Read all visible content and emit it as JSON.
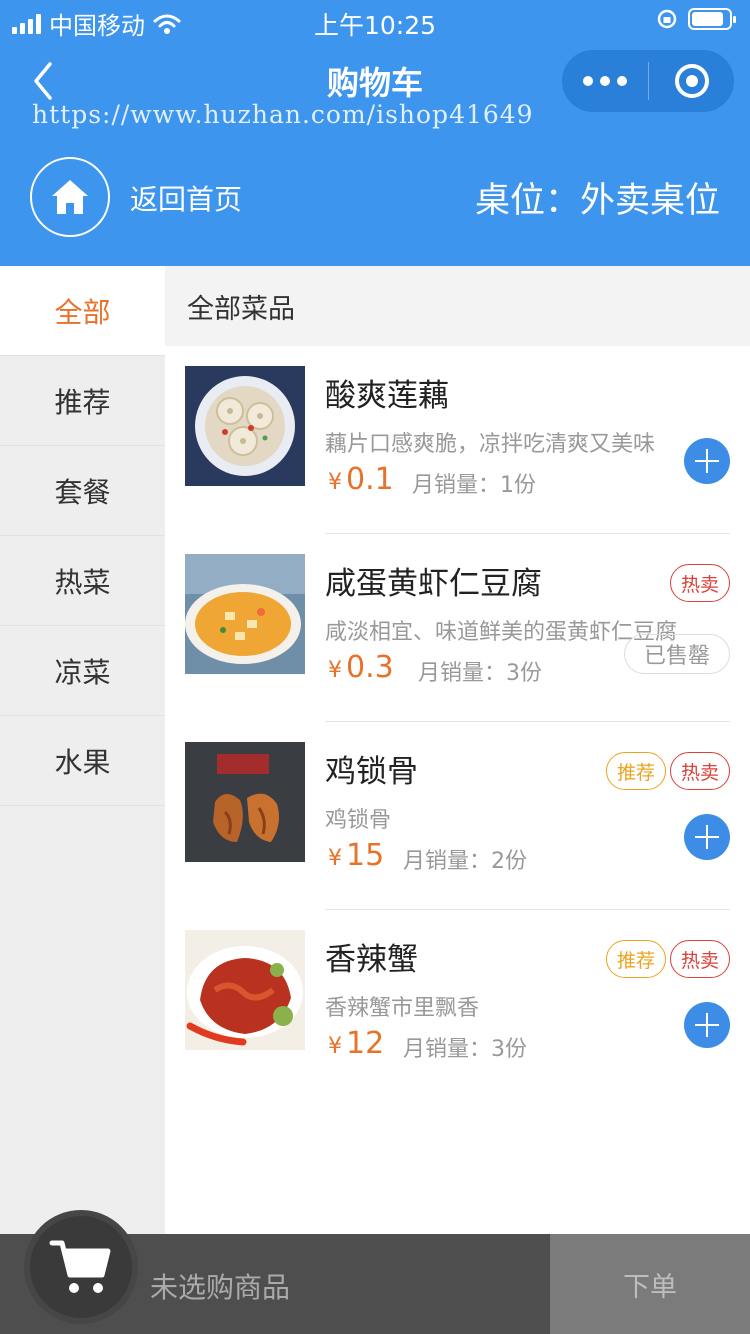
{
  "status_bar": {
    "carrier": "中国移动",
    "time": "上午10:25",
    "battery_level": 0.85
  },
  "nav": {
    "title": "购物车",
    "watermark": "https://www.huzhan.com/ishop41649"
  },
  "header": {
    "home_label": "返回首页",
    "table_info": "桌位：外卖桌位"
  },
  "categories": [
    {
      "label": "全部",
      "active": true
    },
    {
      "label": "推荐",
      "active": false
    },
    {
      "label": "套餐",
      "active": false
    },
    {
      "label": "热菜",
      "active": false
    },
    {
      "label": "凉菜",
      "active": false
    },
    {
      "label": "水果",
      "active": false
    }
  ],
  "section_title": "全部菜品",
  "currency_symbol": "¥",
  "items": [
    {
      "name": "酸爽莲藕",
      "desc": "藕片口感爽脆，凉拌吃清爽又美味",
      "price": "0.1",
      "sales": "月销量：1份",
      "badges": [],
      "action": "add"
    },
    {
      "name": "咸蛋黄虾仁豆腐",
      "desc": "咸淡相宜、味道鲜美的蛋黄虾仁豆腐",
      "price": "0.3",
      "sales": "月销量：3份",
      "badges": [
        "热卖"
      ],
      "action": "soldout",
      "soldout_label": "已售罄"
    },
    {
      "name": "鸡锁骨",
      "desc": "鸡锁骨",
      "price": "15",
      "sales": "月销量：2份",
      "badges": [
        "推荐",
        "热卖"
      ],
      "action": "add"
    },
    {
      "name": "香辣蟹",
      "desc": "香辣蟹市里飘香",
      "price": "12",
      "sales": "月销量：3份",
      "badges": [
        "推荐",
        "热卖"
      ],
      "action": "add"
    }
  ],
  "cart": {
    "empty_text": "未选购商品",
    "order_label": "下单"
  },
  "colors": {
    "primary": "#3d95ee",
    "accent": "#e8722a",
    "hot": "#d9413a",
    "recommend": "#e9a51f"
  }
}
